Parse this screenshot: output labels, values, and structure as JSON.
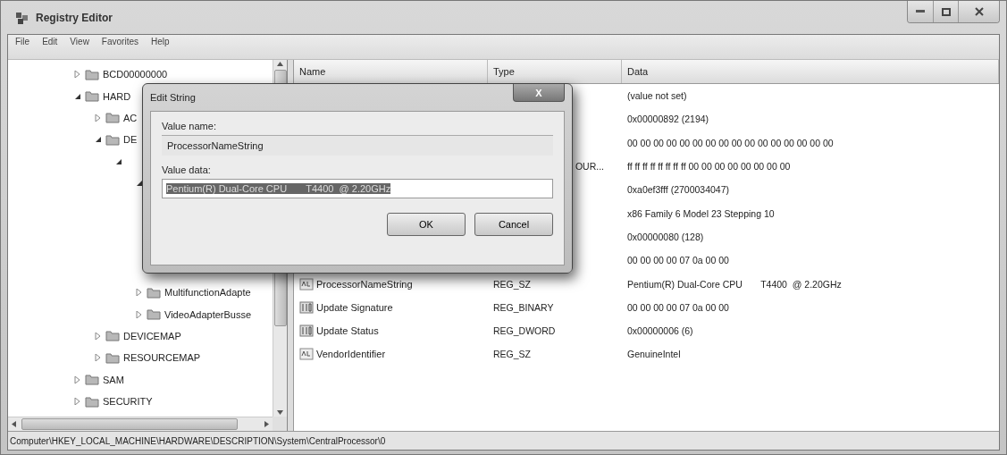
{
  "window": {
    "title": "Registry Editor"
  },
  "menu": [
    "File",
    "Edit",
    "View",
    "Favorites",
    "Help"
  ],
  "tree": [
    {
      "label": "BCD00000000",
      "expanded": false
    },
    {
      "label": "HARD",
      "expanded": true,
      "children": [
        {
          "label": "AC",
          "expanded": false
        },
        {
          "label": "DE",
          "expanded": true,
          "children": [
            {
              "expanded": true,
              "children": [
                {
                  "expanded": true
                },
                {
                  "label": "MultifunctionAdapte",
                  "expanded": false
                },
                {
                  "label": "VideoAdapterBusse",
                  "expanded": false
                }
              ]
            }
          ]
        },
        {
          "label": "DEVICEMAP",
          "expanded": false
        },
        {
          "label": "RESOURCEMAP",
          "expanded": false
        }
      ]
    },
    {
      "label": "SAM",
      "expanded": false
    },
    {
      "label": "SECURITY",
      "expanded": false
    }
  ],
  "list": {
    "columns": [
      "Name",
      "Type",
      "Data"
    ],
    "rows": [
      {
        "data": "(value not set)"
      },
      {
        "data": "0x00000892 (2194)"
      },
      {
        "data": "00 00 00 00 00 00 00 00 00 00 00 00 00 00 00 00"
      },
      {
        "type": "OUR...",
        "data": "ff ff ff ff ff ff ff ff 00 00 00 00 00 00 00 00"
      },
      {
        "data": "0xa0ef3fff (2700034047)"
      },
      {
        "data": "x86 Family 6 Model 23 Stepping 10"
      },
      {
        "data": "0x00000080 (128)"
      },
      {
        "data": "00 00 00 00 07 0a 00 00"
      },
      {
        "kind": "string",
        "name": "ProcessorNameString",
        "type": "REG_SZ",
        "data": "Pentium(R) Dual-Core CPU       T4400  @ 2.20GHz"
      },
      {
        "kind": "binary",
        "name": "Update Signature",
        "type": "REG_BINARY",
        "data": "00 00 00 00 07 0a 00 00"
      },
      {
        "kind": "binary",
        "name": "Update Status",
        "type": "REG_DWORD",
        "data": "0x00000006 (6)"
      },
      {
        "kind": "string",
        "name": "VendorIdentifier",
        "type": "REG_SZ",
        "data": "GenuineIntel"
      }
    ]
  },
  "status_bar": "Computer\\HKEY_LOCAL_MACHINE\\HARDWARE\\DESCRIPTION\\System\\CentralProcessor\\0",
  "dialog": {
    "title": "Edit String",
    "close": "X",
    "value_name": {
      "label": "Value name:",
      "value": "ProcessorNameString"
    },
    "value_data": {
      "label": "Value data:",
      "value": "Pentium(R) Dual-Core CPU       T4400  @ 2.20GHz",
      "selected": true
    },
    "buttons": [
      "OK",
      "Cancel"
    ]
  }
}
